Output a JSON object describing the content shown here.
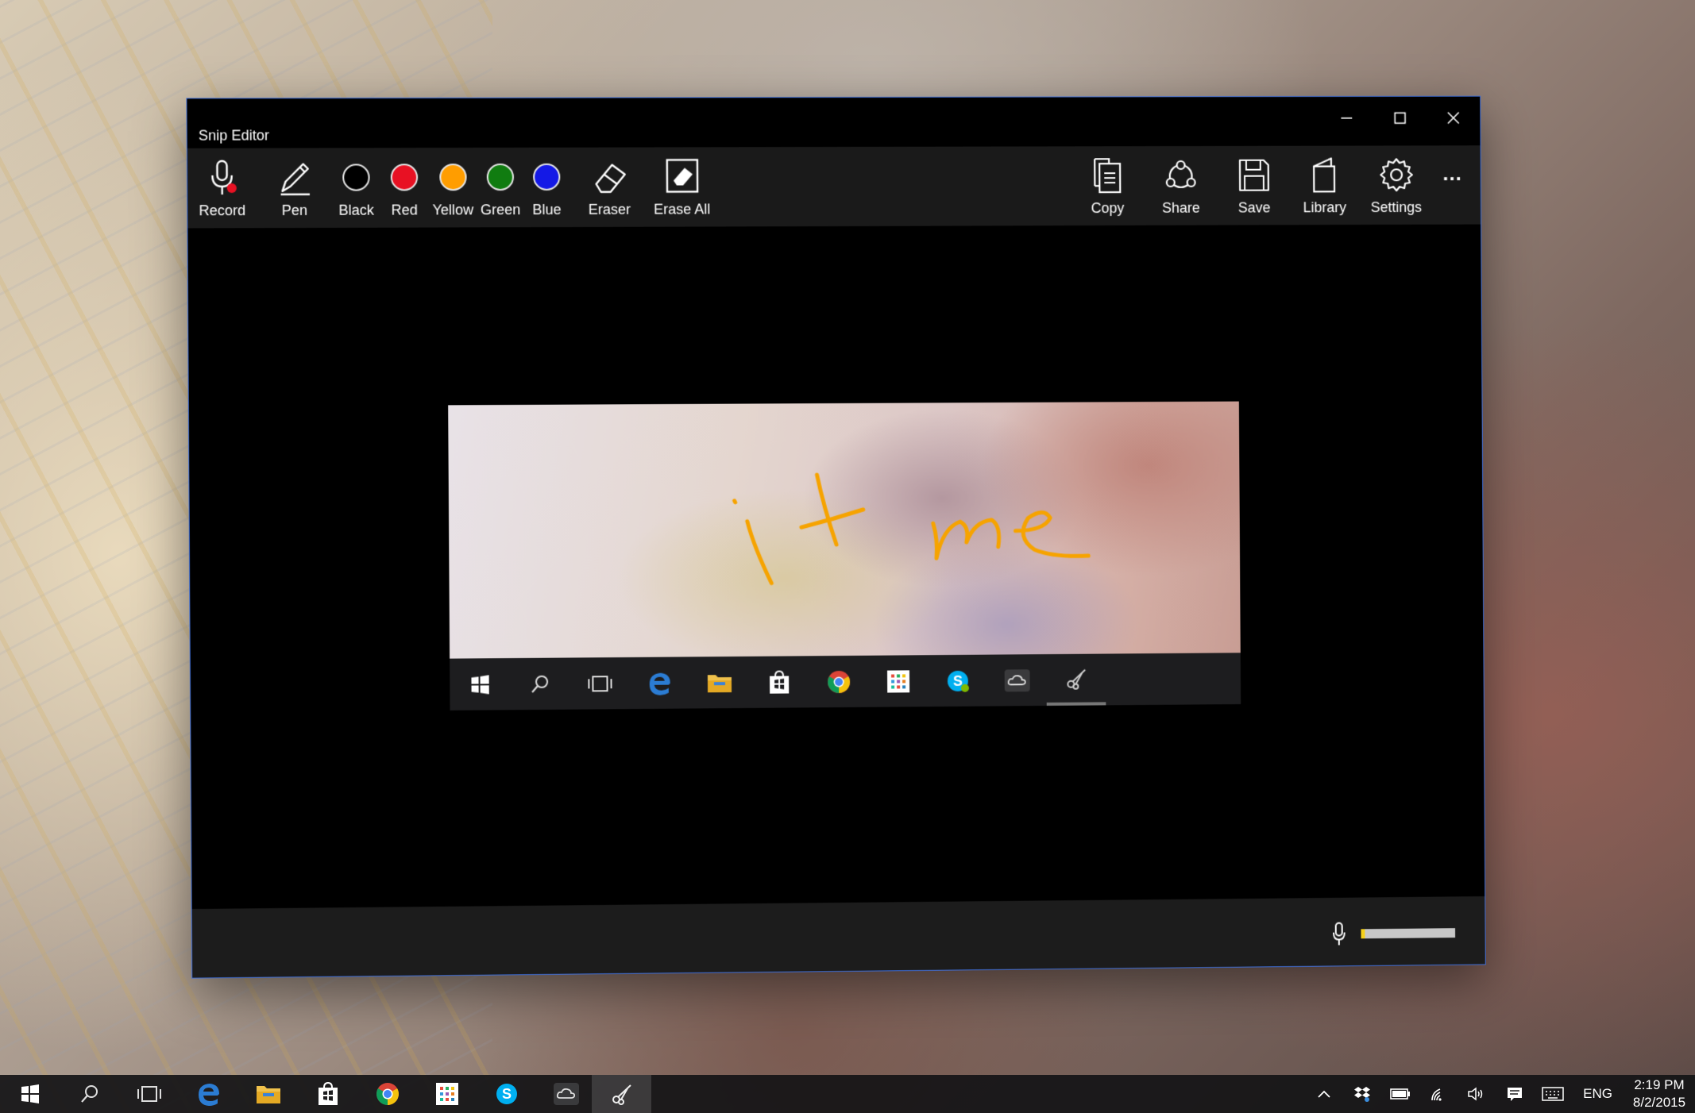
{
  "window": {
    "title": "Snip Editor",
    "controls": [
      "minimize-icon",
      "maximize-icon",
      "close-icon"
    ]
  },
  "toolbar": {
    "left": [
      {
        "id": "record",
        "label": "Record",
        "icon": "microphone-icon"
      },
      {
        "id": "pen",
        "label": "Pen",
        "icon": "pen-icon"
      },
      {
        "id": "black",
        "label": "Black",
        "color": "#000000"
      },
      {
        "id": "red",
        "label": "Red",
        "color": "#e81123"
      },
      {
        "id": "yellow",
        "label": "Yellow",
        "color": "#ff9d00"
      },
      {
        "id": "green",
        "label": "Green",
        "color": "#107c10"
      },
      {
        "id": "blue",
        "label": "Blue",
        "color": "#1419e6"
      },
      {
        "id": "eraser",
        "label": "Eraser",
        "icon": "eraser-icon"
      },
      {
        "id": "erase_all",
        "label": "Erase All",
        "icon": "erase-all-icon"
      }
    ],
    "right": [
      {
        "id": "copy",
        "label": "Copy",
        "icon": "copy-icon"
      },
      {
        "id": "share",
        "label": "Share",
        "icon": "share-icon"
      },
      {
        "id": "save",
        "label": "Save",
        "icon": "save-icon"
      },
      {
        "id": "library",
        "label": "Library",
        "icon": "library-icon"
      },
      {
        "id": "settings",
        "label": "Settings",
        "icon": "gear-icon"
      }
    ],
    "more_label": "..."
  },
  "snip": {
    "ink_color": "#f6a300",
    "handwriting": "it me",
    "taskbar_icons": [
      "windows-start-icon",
      "search-icon",
      "task-view-icon",
      "edge-icon",
      "file-explorer-icon",
      "store-icon",
      "chrome-icon",
      "apps-grid-icon",
      "skype-icon",
      "cloud-icon",
      "snip-scissors-icon"
    ]
  },
  "status": {
    "mic_icon": "microphone-icon",
    "level_fraction": 0.04,
    "level_color": "#f7d21b"
  },
  "taskbar": {
    "apps": [
      "windows-start-icon",
      "search-icon",
      "task-view-icon",
      "edge-icon",
      "file-explorer-icon",
      "store-icon",
      "chrome-icon",
      "apps-grid-icon",
      "skype-icon",
      "cloud-icon",
      "snip-scissors-icon"
    ],
    "tray_icons": [
      "chevron-up-icon",
      "dropbox-icon",
      "battery-icon",
      "wifi-icon",
      "volume-icon",
      "action-center-icon",
      "keyboard-icon"
    ],
    "language": "ENG",
    "time": "2:19 PM",
    "date": "8/2/2015"
  }
}
